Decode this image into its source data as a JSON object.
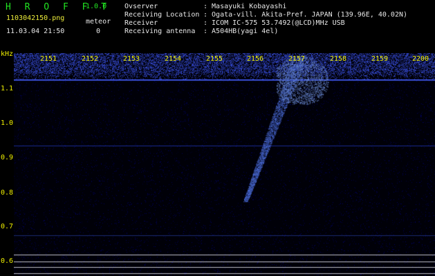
{
  "app": {
    "name": "H R O F F T",
    "version": "1.0.0"
  },
  "file": {
    "name": "1103042150.png",
    "datetime": "11.03.04 21:50"
  },
  "meteor": {
    "label": "meteor",
    "count": "0"
  },
  "info": {
    "rows": [
      {
        "key": "Ovserver",
        "value": ": Masayuki Kobayashi"
      },
      {
        "key": "Receiving Location",
        "value": ": Ogata-vill. Akita-Pref. JAPAN (139.96E, 40.02N)"
      },
      {
        "key": "Receiver",
        "value": ": ICOM IC-575 53.7492(@LCD)MHz USB"
      },
      {
        "key": "Receiving antenna",
        "value": ": A504HB(yagi 4el)"
      }
    ]
  },
  "axes": {
    "unit": "kHz",
    "time_labels": [
      "2151",
      "2152",
      "2153",
      "2154",
      "2155",
      "2156",
      "2157",
      "2158",
      "2159",
      "2200"
    ],
    "freq_labels": [
      "1.1",
      "1.0",
      "0.9",
      "0.8",
      "0.7",
      "0.6"
    ]
  },
  "colors": {
    "title": "#22e422",
    "text": "#e8e8e8",
    "axis": "#f0f000",
    "signal": "#2e5cff",
    "background": "#000000"
  }
}
